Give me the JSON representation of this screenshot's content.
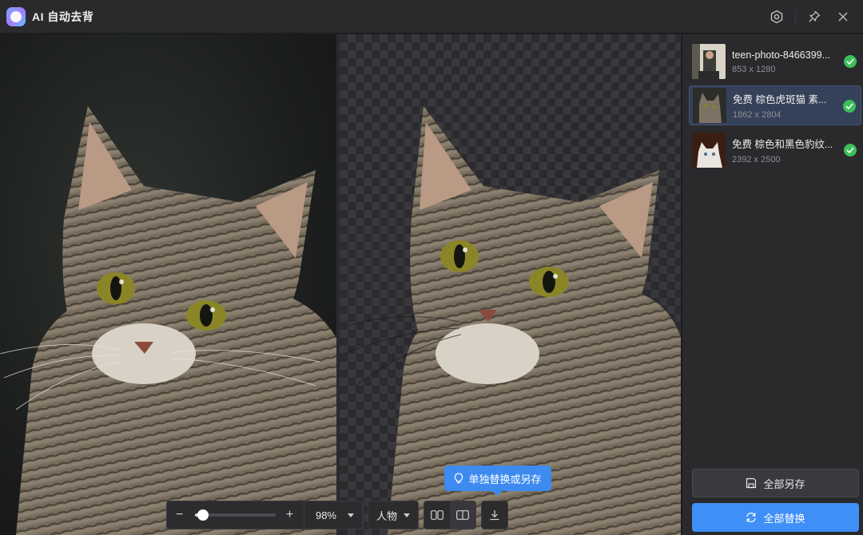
{
  "app": {
    "title": "AI 自动去背"
  },
  "titlebar": {
    "icons": [
      "settings-icon",
      "pin-icon",
      "close-icon"
    ]
  },
  "toolbar": {
    "zoom_minus": "−",
    "zoom_plus": "+",
    "zoom_level": 0.98,
    "zoom_value": "98%",
    "mode_value": "人物",
    "view_icons": [
      "side-by-side-view-icon",
      "split-view-icon"
    ],
    "download_icon": "download-icon"
  },
  "tooltip": {
    "text": "单独替换或另存",
    "icon": "lightbulb-icon"
  },
  "files": [
    {
      "name": "teen-photo-8466399...",
      "size": "853 x 1280",
      "status": "done"
    },
    {
      "name": "免费 棕色虎斑猫 素...",
      "size": "1862 x 2804",
      "status": "done"
    },
    {
      "name": "免费 棕色和黑色豹纹...",
      "size": "2392 x 2500",
      "status": "done"
    }
  ],
  "sidebar": {
    "save_all_label": "全部另存",
    "replace_all_label": "全部替换"
  },
  "colors": {
    "accent": "#3f8ff7",
    "success": "#3dbf5a",
    "selected_row": "#354159",
    "panel": "#2a2a2d"
  }
}
